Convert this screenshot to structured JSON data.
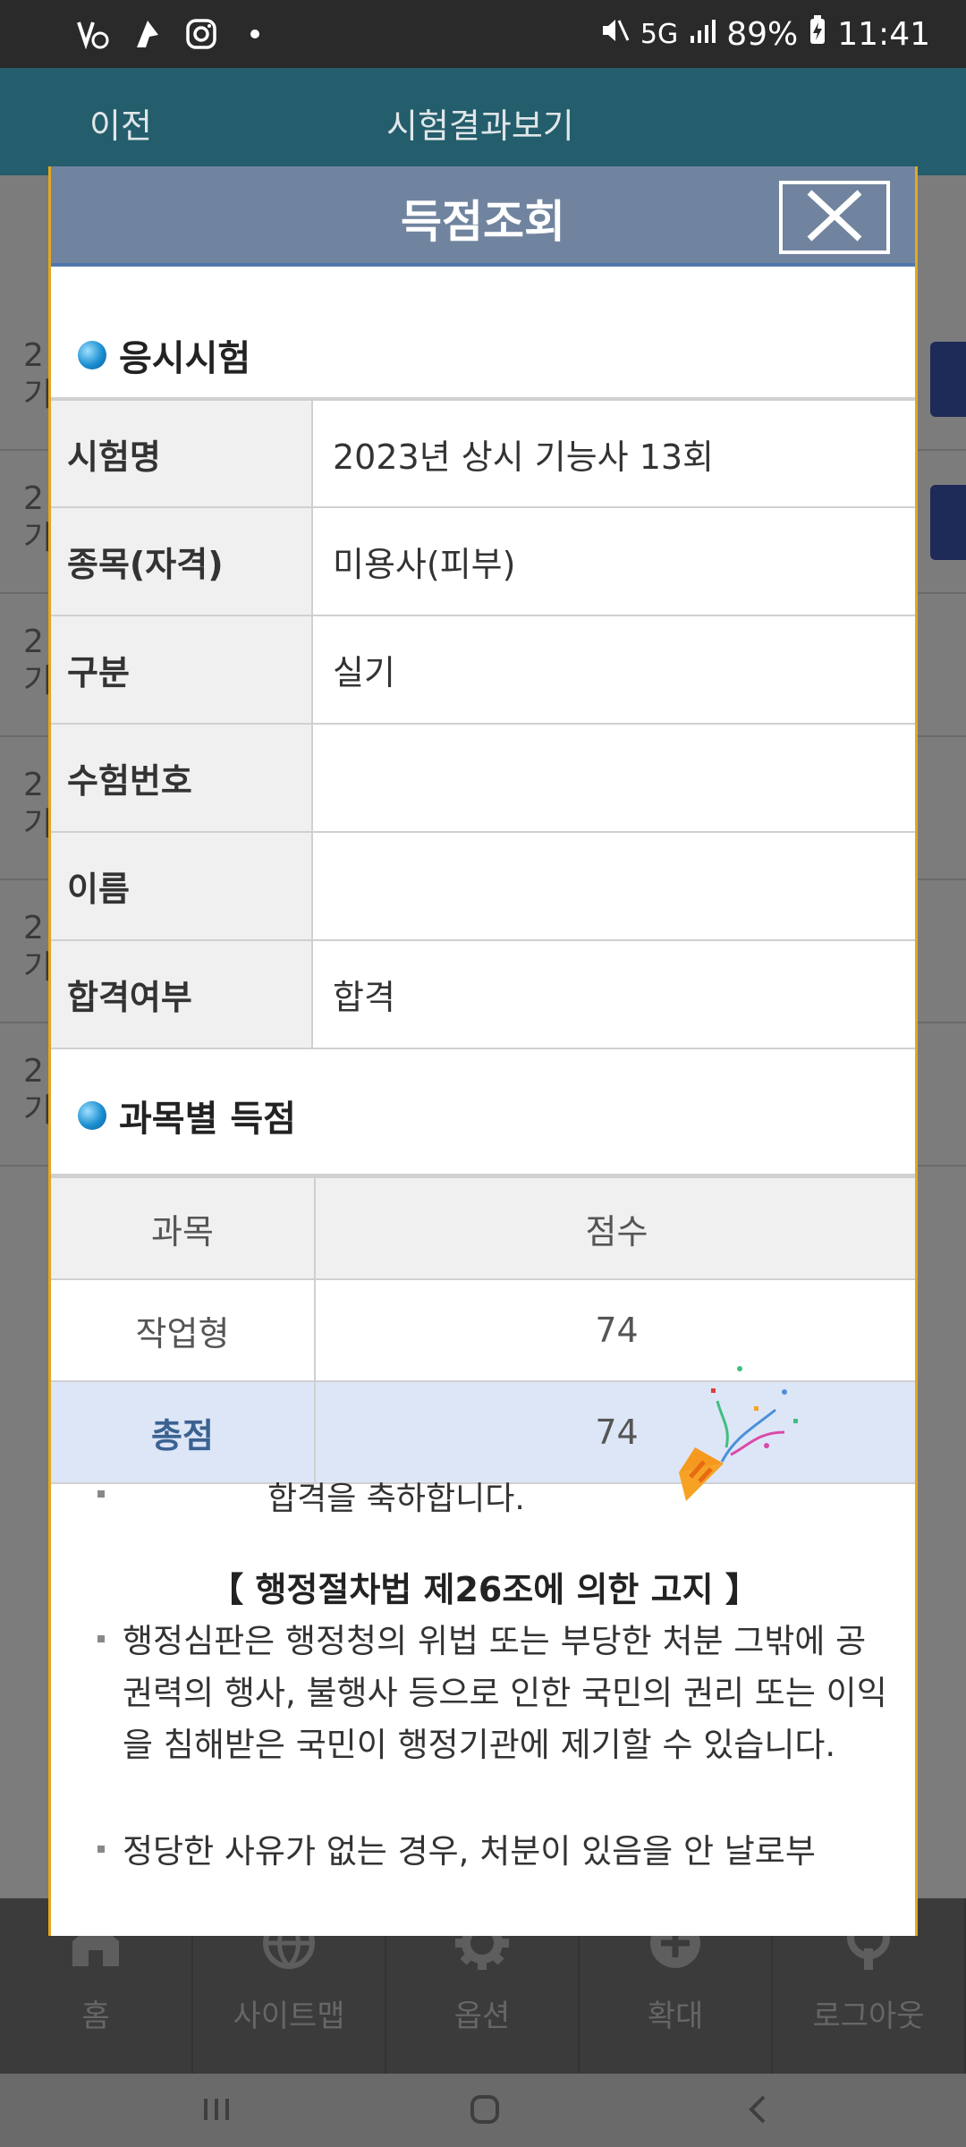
{
  "status_bar": {
    "battery": "89%",
    "time": "11:41",
    "network": "5G"
  },
  "app": {
    "header": {
      "prev_label": "이전",
      "title": "시험결과보기"
    },
    "bg_rows": [
      "2\n기",
      "2\n기",
      "2\n기",
      "2\n기",
      "2\n기",
      "2\n기"
    ],
    "nav": [
      {
        "label": "홈",
        "icon": "home-icon"
      },
      {
        "label": "사이트맵",
        "icon": "globe-icon"
      },
      {
        "label": "옵션",
        "icon": "gear-icon"
      },
      {
        "label": "확대",
        "icon": "plus-icon"
      },
      {
        "label": "로그아웃",
        "icon": "logout-icon"
      }
    ]
  },
  "modal": {
    "title": "득점조회",
    "exam_section_title": "응시시험",
    "info": [
      {
        "key": "시험명",
        "value": "2023년 상시 기능사 13회"
      },
      {
        "key": "종목(자격)",
        "value": "미용사(피부)"
      },
      {
        "key": "구분",
        "value": "실기"
      },
      {
        "key": "수험번호",
        "value": ""
      },
      {
        "key": "이름",
        "value": ""
      },
      {
        "key": "합격여부",
        "value": "합격"
      }
    ],
    "score_section_title": "과목별 득점",
    "score_table": {
      "headers": [
        "과목",
        "점수"
      ],
      "rows": [
        {
          "subject": "작업형",
          "score": "74"
        }
      ],
      "total": {
        "label": "총점",
        "score": "74"
      }
    },
    "congrats": "합격을 축하합니다.",
    "law_title": "【 행정절차법 제26조에 의한 고지 】",
    "paragraphs": [
      "행정심판은 행정청의 위법 또는 부당한 처분 그밖에 공권력의 행사, 불행사 등으로 인한 국민의 권리 또는 이익을 침해받은 국민이 행정기관에 제기할 수 있습니다.",
      "정당한 사유가 없는 경우, 처분이 있음을 안 날로부"
    ]
  },
  "colors": {
    "modal_header": "#71849f",
    "accent_border": "#e2a81e",
    "total_row_bg": "#dde6f7",
    "total_label": "#3b6291"
  }
}
